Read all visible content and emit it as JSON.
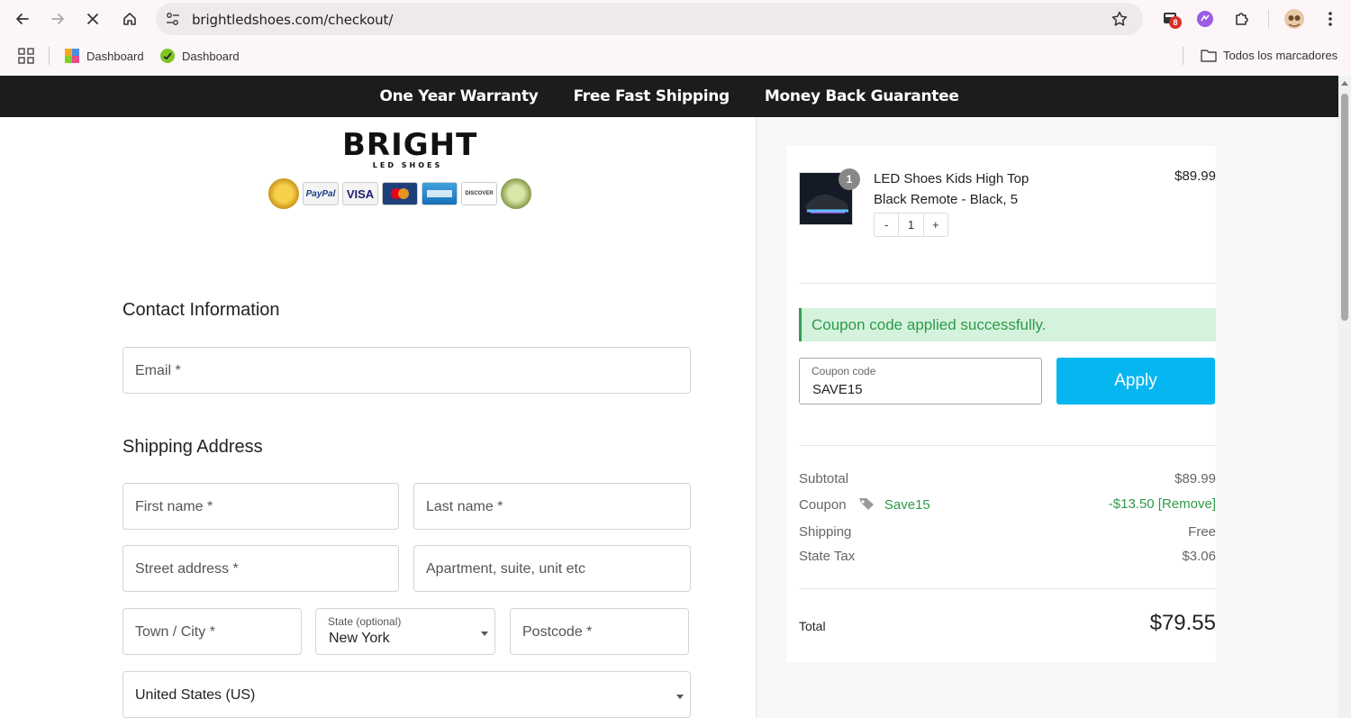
{
  "browser": {
    "url": "brightledshoes.com/checkout/",
    "extension_badge": "8",
    "bookmarks": [
      {
        "label": "Dashboard"
      },
      {
        "label": "Dashboard"
      }
    ],
    "all_bookmarks_label": "Todos los marcadores"
  },
  "promo": {
    "items": [
      "One Year Warranty",
      "Free Fast Shipping",
      "Money Back Guarantee"
    ]
  },
  "logo": {
    "word": "BRIGHT",
    "sub": "LED SHOES",
    "cards": [
      "PayPal",
      "VISA",
      "DISCOVER"
    ]
  },
  "contact": {
    "heading": "Contact Information",
    "email_placeholder": "Email *"
  },
  "shipping": {
    "heading": "Shipping Address",
    "first_name": "First name *",
    "last_name": "Last name *",
    "street": "Street address *",
    "apartment": "Apartment, suite, unit etc",
    "city": "Town / City *",
    "state_label": "State (optional)",
    "state_value": "New York",
    "postcode": "Postcode *",
    "country": "United States (US)"
  },
  "summary": {
    "product": {
      "name": "LED Shoes Kids High Top Black Remote - Black, 5",
      "price": "$89.99",
      "quantity": "1",
      "minus": "-",
      "plus": "+"
    },
    "notice": "Coupon code applied successfully.",
    "coupon_label": "Coupon code",
    "coupon_value": "SAVE15",
    "apply_label": "Apply",
    "subtotal_label": "Subtotal",
    "subtotal_value": "$89.99",
    "coupon_row_label": "Coupon",
    "coupon_row_code": "Save15",
    "coupon_row_value": "-$13.50 [Remove]",
    "shipping_label": "Shipping",
    "shipping_value": "Free",
    "tax_label": "State Tax",
    "tax_value": "$3.06",
    "total_label": "Total",
    "total_value": "$79.55"
  },
  "colors": {
    "accent": "#06b6f0",
    "success": "#2d9b4a",
    "success_bg": "#d5f2dd",
    "promo_bar": "#1c1c1c"
  }
}
